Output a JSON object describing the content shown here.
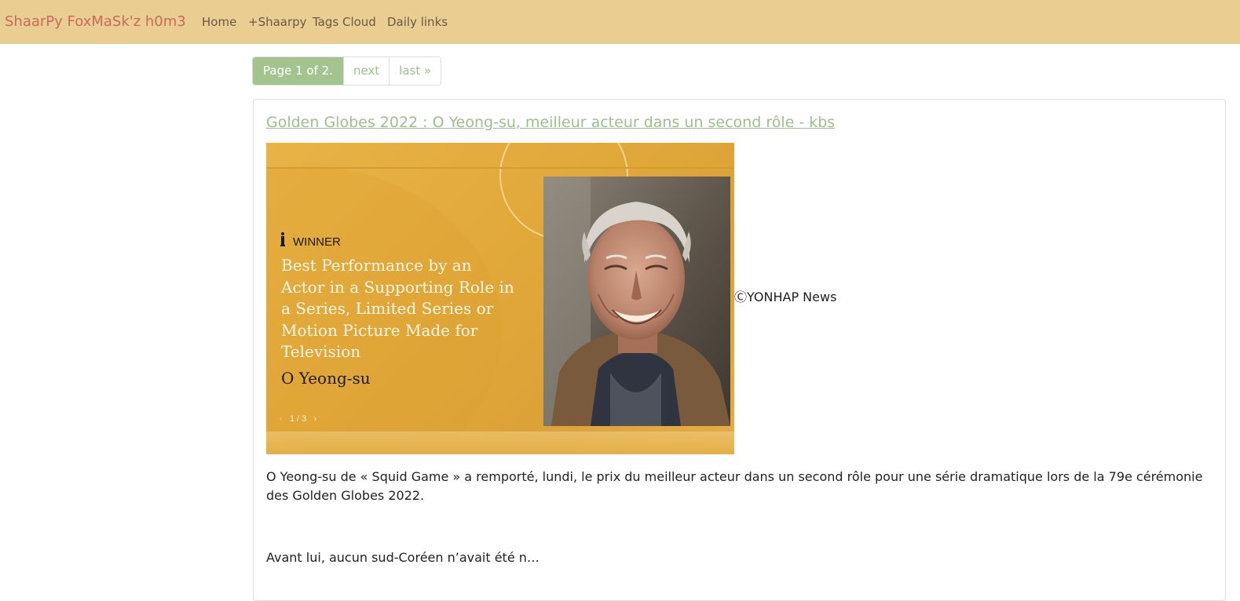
{
  "navbar": {
    "brand": "ShaarPy FoxMaSk'z h0m3",
    "links": [
      {
        "label": "Home"
      },
      {
        "label": "+Shaarpy"
      },
      {
        "label": "Tags Cloud"
      },
      {
        "label": "Daily links"
      }
    ]
  },
  "pagination": {
    "current": "Page 1 of 2.",
    "next": "next",
    "last": "last »"
  },
  "entry": {
    "title": "Golden Globes 2022 : O Yeong-su, meilleur acteur dans un second rôle - kbs",
    "image": {
      "winner_label": "WINNER",
      "award": "Best Performance by an Actor in a Supporting Role in a Series, Limited Series or Motion Picture Made for Television",
      "winner_name": "O Yeong-su",
      "slide_current": "1",
      "slide_separator": "/",
      "slide_total": "3",
      "prev_glyph": "‹",
      "next_glyph": "›"
    },
    "image_credit": "ⒸYONHAP News",
    "paragraphs": [
      "O Yeong-su de « Squid Game » a remporté, lundi, le prix du meilleur acteur dans un second rôle pour une série dramatique lors de la 79e cérémonie des Golden Globes 2022.",
      "Avant lui, aucun sud-Coréen n’avait été n…"
    ]
  },
  "colors": {
    "navbar_bg": "#e9cd91",
    "brand": "#c96a5d",
    "accent_green": "#a3c48f",
    "link_green": "#9dbf8c",
    "banner_gold": "#e1a83a"
  }
}
